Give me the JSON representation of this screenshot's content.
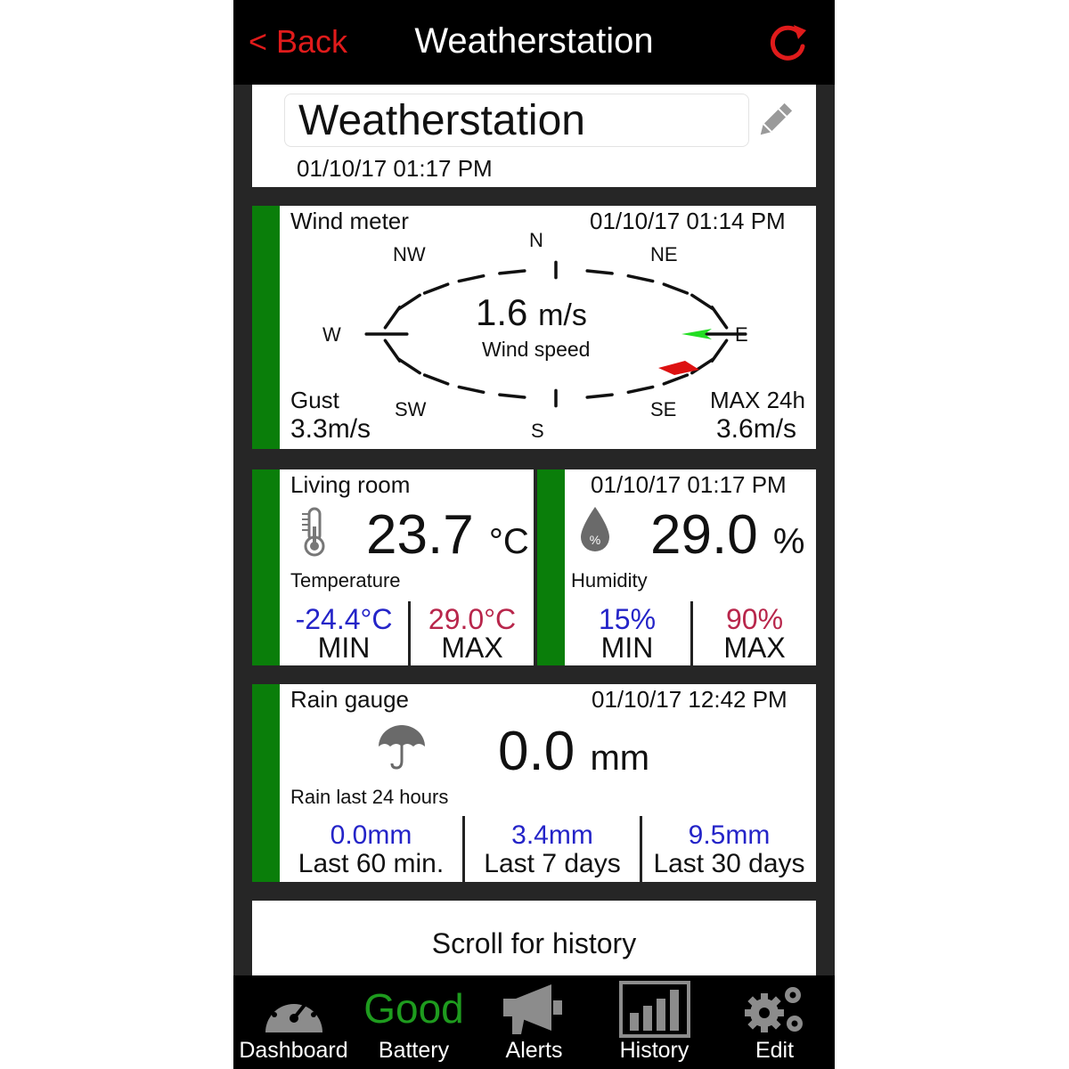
{
  "topbar": {
    "back_label": "< Back",
    "title": "Weatherstation"
  },
  "station": {
    "name": "Weatherstation",
    "datetime": "01/10/17  01:17 PM"
  },
  "wind": {
    "title": "Wind meter",
    "datetime": "01/10/17  01:14 PM",
    "speed_value": "1.6",
    "speed_unit": "m/s",
    "speed_caption": "Wind speed",
    "directions": {
      "n": "N",
      "ne": "NE",
      "e": "E",
      "se": "SE",
      "s": "S",
      "sw": "SW",
      "w": "W",
      "nw": "NW"
    },
    "gust_label": "Gust",
    "gust_value": "3.3m/s",
    "max_label": "MAX 24h",
    "max_value": "3.6m/s",
    "indicator_colors": {
      "current": "#22dd22",
      "max": "#dd1111"
    }
  },
  "temperature": {
    "room": "Living room",
    "value": "23.7",
    "unit": "°C",
    "caption": "Temperature",
    "min_value": "-24.4°C",
    "min_label": "MIN",
    "max_value": "29.0°C",
    "max_label": "MAX"
  },
  "humidity": {
    "datetime": "01/10/17  01:17 PM",
    "value": "29.0",
    "unit": "%",
    "caption": "Humidity",
    "min_value": "15%",
    "min_label": "MIN",
    "max_value": "90%",
    "max_label": "MAX"
  },
  "rain": {
    "title": "Rain gauge",
    "datetime": "01/10/17  12:42 PM",
    "value": "0.0",
    "unit": "mm",
    "caption": "Rain last 24 hours",
    "periods": [
      {
        "value": "0.0mm",
        "label": "Last 60 min."
      },
      {
        "value": "3.4mm",
        "label": "Last 7 days"
      },
      {
        "value": "9.5mm",
        "label": "Last 30 days"
      }
    ]
  },
  "scroll_hint": "Scroll for history",
  "tabs": [
    {
      "label": "Dashboard",
      "icon": "gauge-icon"
    },
    {
      "label": "Battery",
      "status": "Good"
    },
    {
      "label": "Alerts",
      "icon": "megaphone-icon"
    },
    {
      "label": "History",
      "icon": "bar-chart-icon"
    },
    {
      "label": "Edit",
      "icon": "gears-icon"
    }
  ],
  "colors": {
    "accent_red": "#e01b1b",
    "strip_green": "#0a7e0a",
    "min_blue": "#2424c8",
    "max_rose": "#b8264b",
    "good_green": "#1e9b1e"
  }
}
